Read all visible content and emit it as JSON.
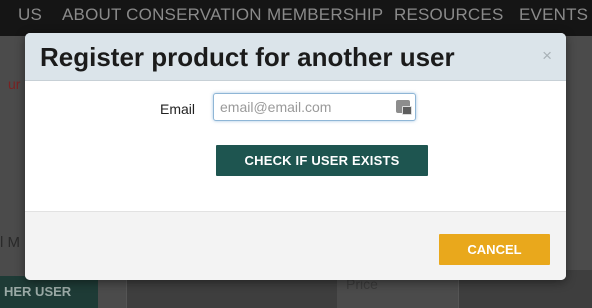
{
  "background": {
    "nav_items": [
      "US",
      "ABOUT CONSERVATION",
      "MEMBERSHIP",
      "RESOURCES",
      "EVENTS"
    ],
    "red_fragment": "ur",
    "left_fragment": "l M",
    "dark_button_fragment": "HER USER",
    "price_label": "Price"
  },
  "modal": {
    "title": "Register product for another user",
    "close_symbol": "×",
    "email_label": "Email",
    "email_placeholder": "email@email.com",
    "email_value": "",
    "check_button_label": "CHECK IF USER EXISTS",
    "cancel_button_label": "CANCEL",
    "autofill_icon": "autofill-key-icon"
  },
  "colors": {
    "header_bg": "#dbe4ea",
    "primary_button": "#1e5550",
    "cancel_button": "#e9a81c"
  }
}
